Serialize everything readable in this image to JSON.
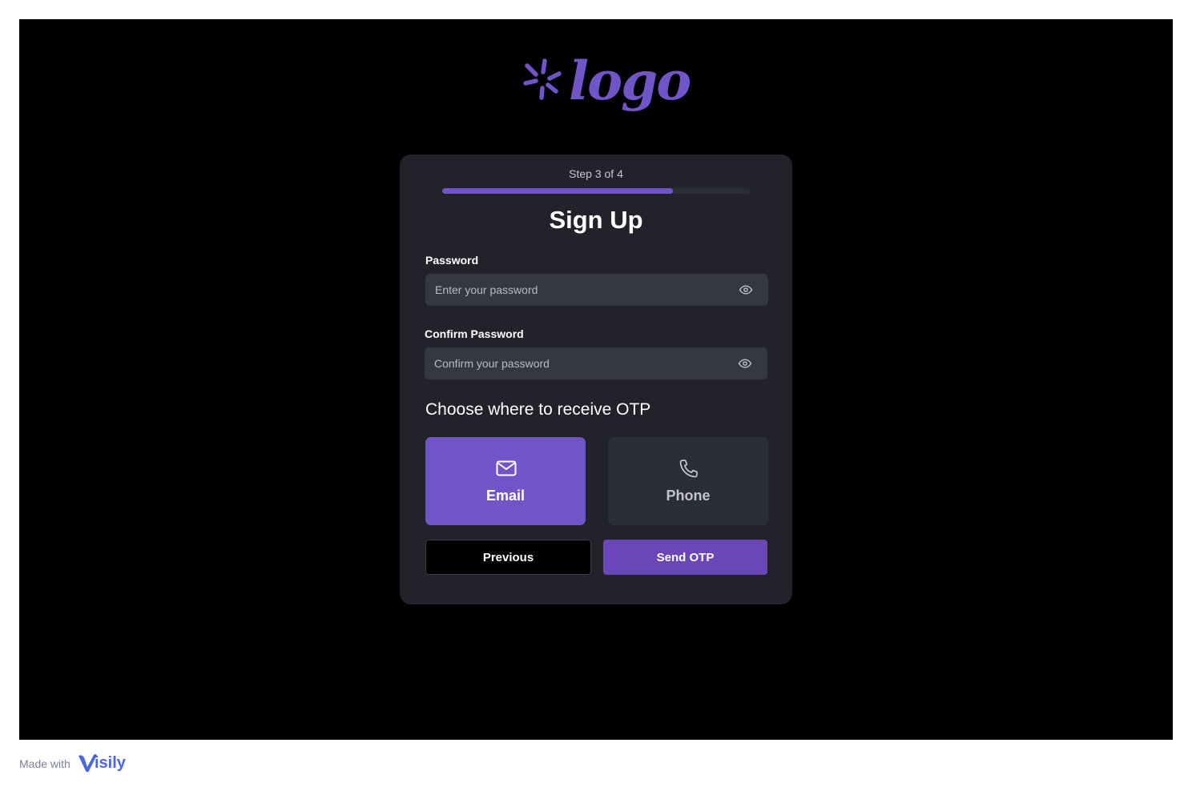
{
  "logo": {
    "text": "logo",
    "color": "#7054c8"
  },
  "signup": {
    "step_text": "Step 3 of 4",
    "progress": 0.75,
    "title": "Sign Up",
    "password": {
      "label": "Password",
      "placeholder": "Enter your password",
      "value": ""
    },
    "confirm_password": {
      "label": "Confirm Password",
      "placeholder": "Confirm your password",
      "value": ""
    },
    "otp": {
      "heading": "Choose where to receive OTP",
      "options": [
        {
          "label": "Email",
          "icon": "mail-icon",
          "selected": true
        },
        {
          "label": "Phone",
          "icon": "phone-icon",
          "selected": false
        }
      ]
    },
    "buttons": {
      "previous": "Previous",
      "send": "Send OTP"
    }
  },
  "footer": {
    "made_with": "Made with",
    "brand": "isily"
  },
  "colors": {
    "background": "#000000",
    "card": "#22232a",
    "input": "#353743",
    "accent": "#7054c8",
    "button_primary": "#6a46b8",
    "brand": "#4a66e0"
  }
}
